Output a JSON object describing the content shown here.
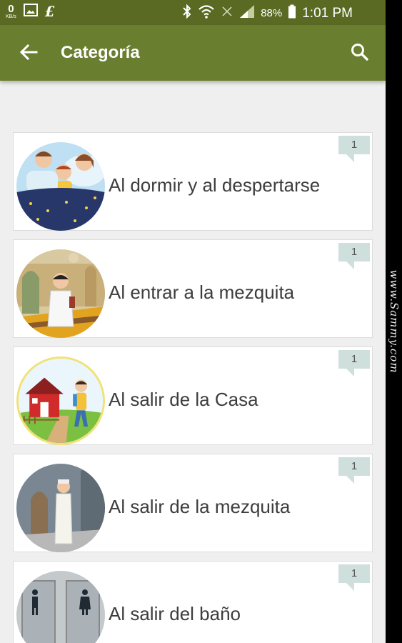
{
  "status_bar": {
    "kb_value": "0",
    "kb_unit": "KB/s",
    "battery": "88%",
    "time": "1:01 PM"
  },
  "app_bar": {
    "title": "Categoría"
  },
  "categories": [
    {
      "label": "Al dormir y al despertarse",
      "count": "1",
      "illustration": "family-sleeping"
    },
    {
      "label": "Al entrar a la mezquita",
      "count": "1",
      "illustration": "child-entering-mosque"
    },
    {
      "label": "Al salir de la Casa",
      "count": "1",
      "illustration": "child-leaving-house"
    },
    {
      "label": "Al salir de la mezquita",
      "count": "1",
      "illustration": "man-leaving-mosque"
    },
    {
      "label": "Al salir del baño",
      "count": "1",
      "illustration": "restroom-doors"
    }
  ],
  "watermark": "www.Sammy.com",
  "colors": {
    "status_bar": "#5a6a23",
    "app_bar": "#6a7e2f",
    "badge": "#cfe0dc",
    "background": "#efefef"
  }
}
